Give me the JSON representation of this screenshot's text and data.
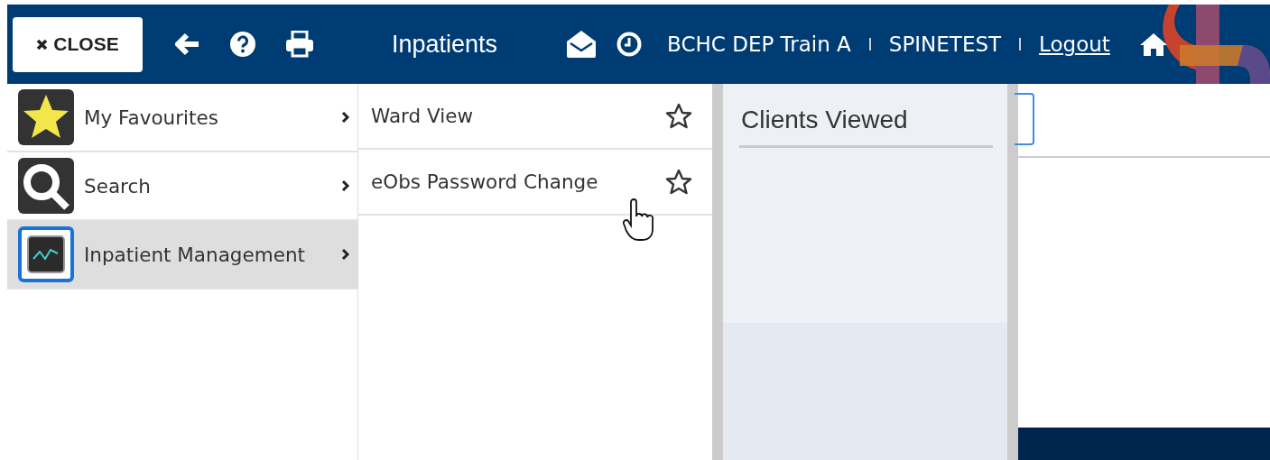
{
  "header": {
    "close_button": "CLOSE",
    "title": "Inpatients",
    "location": "BCHC DEP Train A",
    "user": "SPINETEST",
    "logout": "Logout"
  },
  "menu": {
    "items": [
      {
        "label": "My Favourites",
        "kind": "favourites",
        "selected": false
      },
      {
        "label": "Search",
        "kind": "search",
        "selected": false
      },
      {
        "label": "Inpatient Management",
        "kind": "monitor",
        "selected": true
      }
    ]
  },
  "submenu": {
    "items": [
      {
        "label": "Ward View",
        "favourite": false,
        "hovered": false
      },
      {
        "label": "eObs Password Change",
        "favourite": false,
        "hovered": true
      }
    ]
  },
  "clients_panel": {
    "title": "Clients Viewed"
  }
}
